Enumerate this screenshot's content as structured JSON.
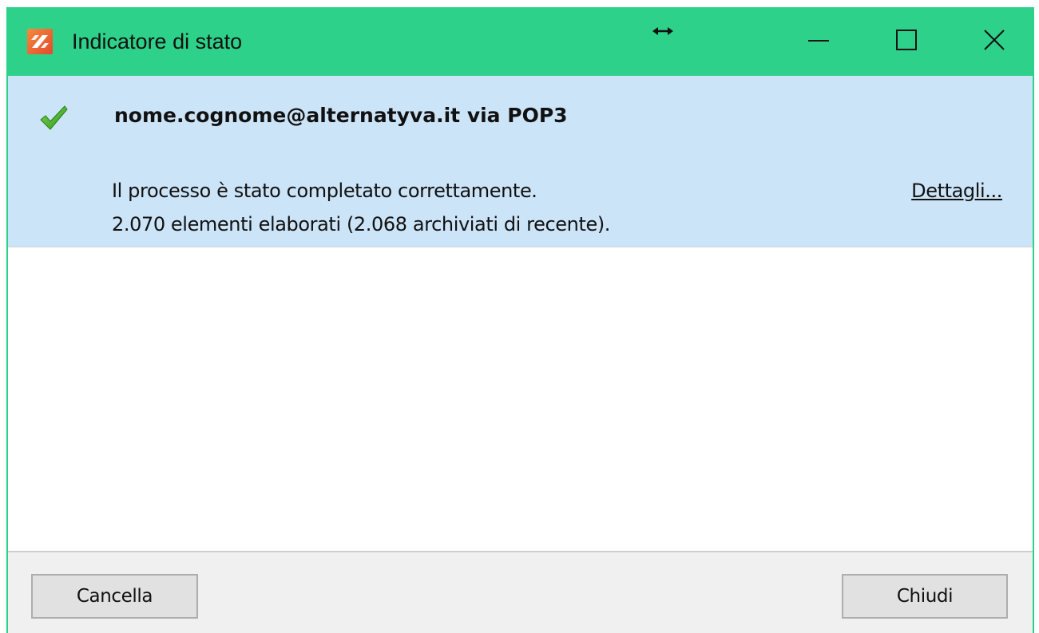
{
  "window": {
    "title": "Indicatore di stato",
    "icon": "app-logo-icon",
    "title_bar_color": "#2ed18a",
    "controls": {
      "minimize_icon": "minimize-icon",
      "maximize_icon": "maximize-icon",
      "close_icon": "close-icon",
      "resize_icon": "resize-horizontal-icon"
    }
  },
  "status": {
    "icon": "checkmark-icon",
    "account_title": "nome.cognome@alternatyva.it via POP3",
    "line1": "Il processo è stato completato correttamente.",
    "line2": "2.070 elementi elaborati (2.068 archiviati di recente).",
    "details_link": "Dettagli...",
    "panel_color": "#cce4f7"
  },
  "footer": {
    "cancel_label": "Cancella",
    "close_label": "Chiudi"
  }
}
